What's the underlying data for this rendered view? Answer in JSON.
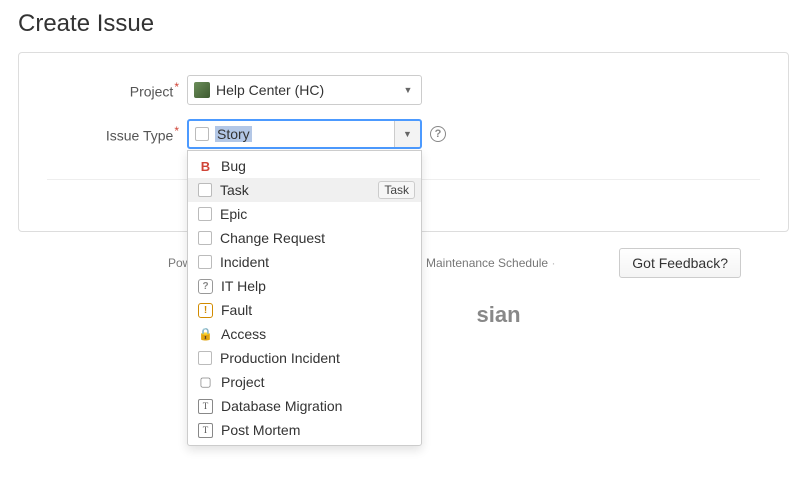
{
  "page": {
    "title": "Create Issue"
  },
  "form": {
    "labels": {
      "project": "Project",
      "issue_type": "Issue Type"
    },
    "project": {
      "value": "Help Center (HC)"
    },
    "issue_type": {
      "selected": "Story",
      "options": [
        {
          "label": "Bug",
          "icon": "bug"
        },
        {
          "label": "Task",
          "icon": "box",
          "hover": true,
          "tooltip": "Task"
        },
        {
          "label": "Epic",
          "icon": "box"
        },
        {
          "label": "Change Request",
          "icon": "box"
        },
        {
          "label": "Incident",
          "icon": "box"
        },
        {
          "label": "IT Help",
          "icon": "help"
        },
        {
          "label": "Fault",
          "icon": "fault"
        },
        {
          "label": "Access",
          "icon": "lock"
        },
        {
          "label": "Production Incident",
          "icon": "box"
        },
        {
          "label": "Project",
          "icon": "proj"
        },
        {
          "label": "Database Migration",
          "icon": "task"
        },
        {
          "label": "Post Mortem",
          "icon": "task"
        }
      ]
    }
  },
  "footer": {
    "powered": "Powered",
    "maintenance": "Maintenance Schedule",
    "feedback": "Got Feedback?",
    "brand_suffix": "sian"
  }
}
